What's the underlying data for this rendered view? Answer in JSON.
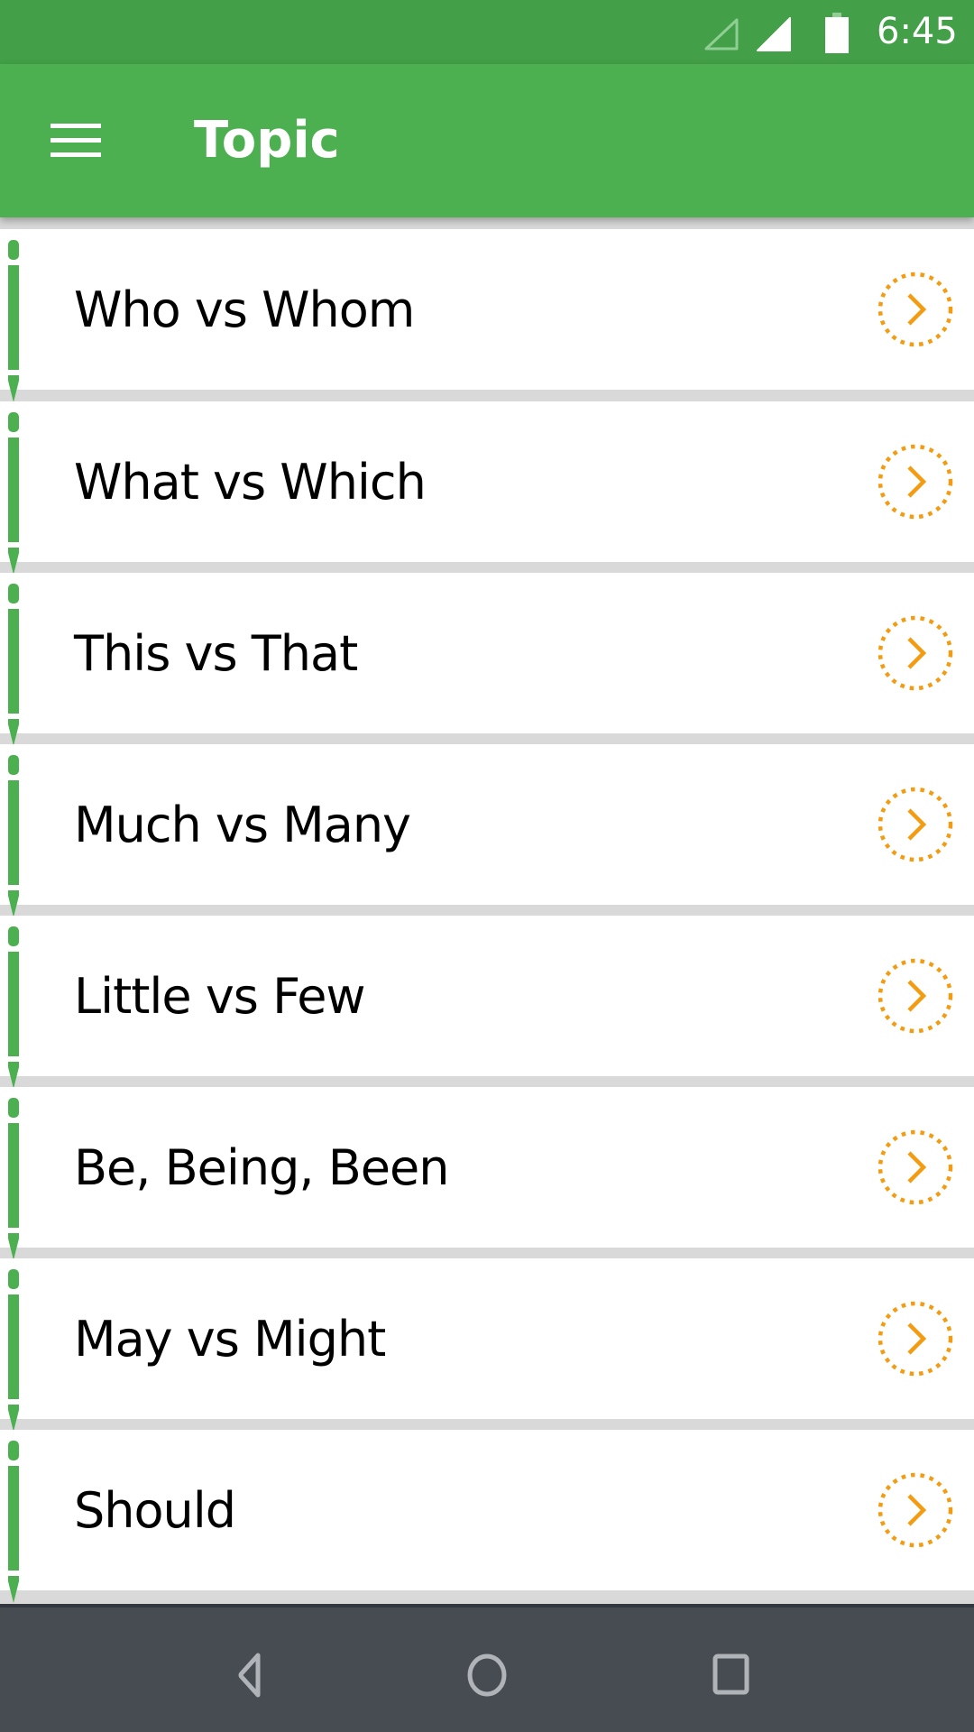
{
  "status_bar": {
    "time": "6:45",
    "icons": [
      "signal-empty-icon",
      "signal-full-icon",
      "battery-icon"
    ]
  },
  "app_bar": {
    "menu_icon": "hamburger-menu-icon",
    "title": "Topic"
  },
  "topics": [
    {
      "label": "Who vs Whom"
    },
    {
      "label": "What vs Which"
    },
    {
      "label": "This vs That"
    },
    {
      "label": "Much vs Many"
    },
    {
      "label": "Little vs Few"
    },
    {
      "label": "Be, Being, Been"
    },
    {
      "label": "May vs Might"
    },
    {
      "label": "Should"
    }
  ],
  "row_icons": {
    "left": "pencil-icon",
    "right": "chevron-right-circle-icon"
  },
  "nav_bar": {
    "buttons": [
      "back-icon",
      "home-icon",
      "recents-icon"
    ]
  },
  "colors": {
    "status_bar": "#439f48",
    "app_bar": "#4caf50",
    "pencil": "#4caf50",
    "chevron_accent": "#f39c12",
    "separator": "#d9d9d9",
    "nav_bar": "#464c52",
    "nav_icons": "#b0b4b8"
  }
}
